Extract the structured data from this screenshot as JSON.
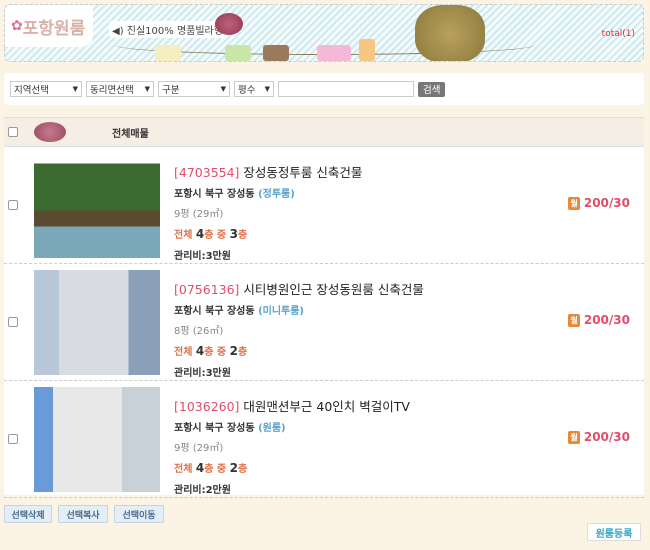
{
  "banner": {
    "logo": "포항원룸",
    "slogan": "진실100% 명품빌라형",
    "total": "total(1)"
  },
  "search": {
    "selects": [
      "지역선택",
      "동리면선택",
      "구분",
      "평수"
    ],
    "input_value": "",
    "button": "검색"
  },
  "list": {
    "header": "전체매물",
    "items": [
      {
        "code": "[4703554]",
        "title": "장성동정투룸 신축건물",
        "addr": "포항시 북구 장성동",
        "type": "(정투룸)",
        "size": "9평 (29㎡)",
        "floor_total_label": "전체",
        "floor_total": "4",
        "floor_mid": "층 중",
        "floor_cur": "3",
        "floor_unit": "층",
        "fee": "관리비:3만원",
        "badge": "월",
        "price": "200/30"
      },
      {
        "code": "[0756136]",
        "title": "시티병원인근 장성동원룸 신축건물",
        "addr": "포항시 북구 장성동",
        "type": "(미니투룸)",
        "size": "8평 (26㎡)",
        "floor_total_label": "전체",
        "floor_total": "4",
        "floor_mid": "층 중",
        "floor_cur": "2",
        "floor_unit": "층",
        "fee": "관리비:3만원",
        "badge": "월",
        "price": "200/30"
      },
      {
        "code": "[1036260]",
        "title": "대원맨션부근 40인치 벽걸이TV",
        "addr": "포항시 북구 장성동",
        "type": "(원룸)",
        "size": "9평 (29㎡)",
        "floor_total_label": "전체",
        "floor_total": "4",
        "floor_mid": "층 중",
        "floor_cur": "2",
        "floor_unit": "층",
        "fee": "관리비:2만원",
        "badge": "월",
        "price": "200/30"
      }
    ]
  },
  "actions": {
    "delete": "선택삭제",
    "copy": "선택복사",
    "move": "선택이동",
    "register": "원룸등록"
  }
}
